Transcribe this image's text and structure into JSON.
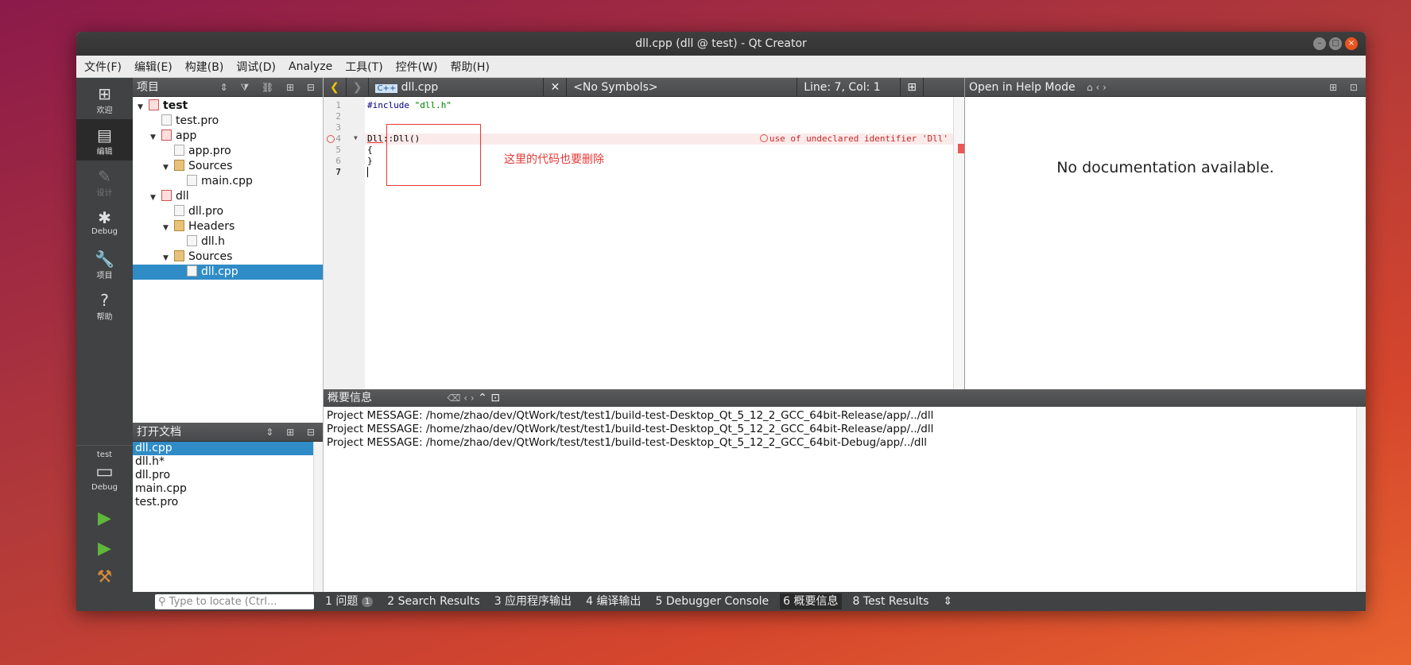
{
  "window": {
    "title": "dll.cpp (dll @ test) - Qt Creator"
  },
  "menu": [
    "文件(F)",
    "编辑(E)",
    "构建(B)",
    "调试(D)",
    "Analyze",
    "工具(T)",
    "控件(W)",
    "帮助(H)"
  ],
  "modes": [
    {
      "label": "欢迎",
      "icon": "grid-icon",
      "glyph": "⊞"
    },
    {
      "label": "编辑",
      "icon": "edit-icon",
      "glyph": "▤"
    },
    {
      "label": "设计",
      "icon": "design-icon",
      "glyph": "✎"
    },
    {
      "label": "Debug",
      "icon": "bug-icon",
      "glyph": "✱"
    },
    {
      "label": "项目",
      "icon": "wrench-icon",
      "glyph": "🔧"
    },
    {
      "label": "帮助",
      "icon": "help-icon",
      "glyph": "?"
    }
  ],
  "kit": {
    "project": "test",
    "mode": "Debug"
  },
  "projects_pane": {
    "title": "项目"
  },
  "tree": [
    {
      "label": "test",
      "depth": 0,
      "expanded": true,
      "bold": true,
      "type": "project"
    },
    {
      "label": "test.pro",
      "depth": 1,
      "type": "pro"
    },
    {
      "label": "app",
      "depth": 1,
      "expanded": true,
      "type": "project"
    },
    {
      "label": "app.pro",
      "depth": 2,
      "type": "pro"
    },
    {
      "label": "Sources",
      "depth": 2,
      "expanded": true,
      "type": "folder"
    },
    {
      "label": "main.cpp",
      "depth": 3,
      "type": "cpp"
    },
    {
      "label": "dll",
      "depth": 1,
      "expanded": true,
      "type": "project"
    },
    {
      "label": "dll.pro",
      "depth": 2,
      "type": "pro"
    },
    {
      "label": "Headers",
      "depth": 2,
      "expanded": true,
      "type": "folder"
    },
    {
      "label": "dll.h",
      "depth": 3,
      "type": "h"
    },
    {
      "label": "Sources",
      "depth": 2,
      "expanded": true,
      "type": "folder"
    },
    {
      "label": "dll.cpp",
      "depth": 3,
      "type": "cpp",
      "selected": true
    }
  ],
  "open_docs": {
    "title": "打开文档",
    "items": [
      "dll.cpp",
      "dll.h*",
      "dll.pro",
      "main.cpp",
      "test.pro"
    ],
    "selected": 0
  },
  "editor": {
    "file": "dll.cpp",
    "symbols": "<No Symbols>",
    "position": "Line: 7, Col: 1",
    "line_numbers": [
      "1",
      "2",
      "3",
      "4",
      "5",
      "6",
      "7"
    ],
    "error": "use of undeclared identifier 'Dll'",
    "annotation": "这里的代码也要删除"
  },
  "help": {
    "mode_label": "Open in Help Mode",
    "message": "No documentation available."
  },
  "output": {
    "title": "概要信息",
    "lines": [
      "Project MESSAGE: /home/zhao/dev/QtWork/test/test1/build-test-Desktop_Qt_5_12_2_GCC_64bit-Release/app/../dll",
      "Project MESSAGE: /home/zhao/dev/QtWork/test/test1/build-test-Desktop_Qt_5_12_2_GCC_64bit-Release/app/../dll",
      "Project MESSAGE: /home/zhao/dev/QtWork/test/test1/build-test-Desktop_Qt_5_12_2_GCC_64bit-Debug/app/../dll"
    ]
  },
  "status": {
    "locator_placeholder": "Type to locate (Ctrl...",
    "tabs": [
      {
        "num": "1",
        "label": "问题",
        "badge": "1"
      },
      {
        "num": "2",
        "label": "Search Results"
      },
      {
        "num": "3",
        "label": "应用程序输出"
      },
      {
        "num": "4",
        "label": "编译输出"
      },
      {
        "num": "5",
        "label": "Debugger Console"
      },
      {
        "num": "6",
        "label": "概要信息",
        "active": true
      },
      {
        "num": "8",
        "label": "Test Results"
      }
    ]
  }
}
